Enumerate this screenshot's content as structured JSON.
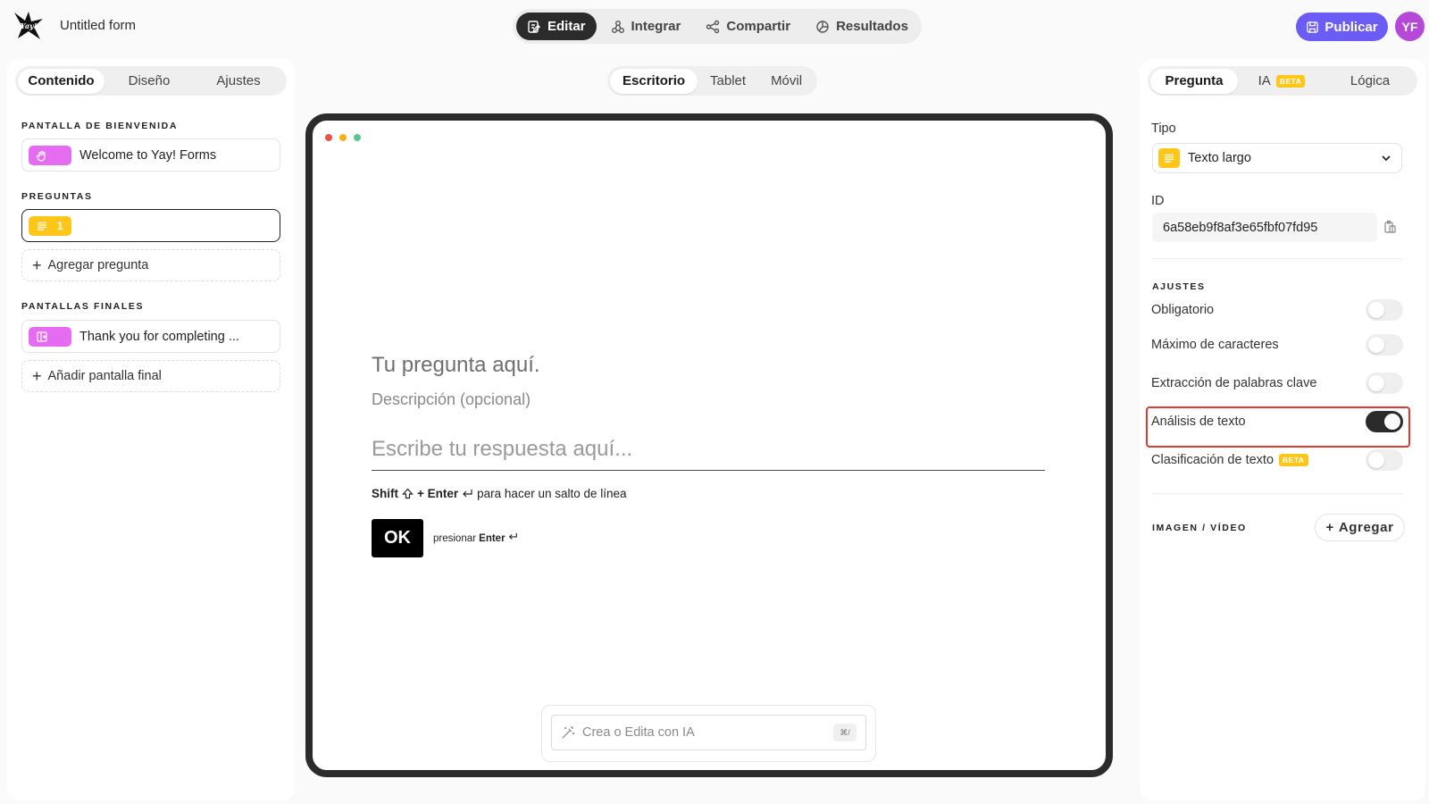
{
  "app": {
    "form_title": "Untitled form",
    "logo_icon": "yay-forms-logo",
    "accent_color": "#6a5cf5",
    "avatar_initials": "YF",
    "avatar_color": "#b548d8"
  },
  "top_nav": {
    "modes": [
      {
        "label": "Editar",
        "icon": "edit-icon",
        "active": true
      },
      {
        "label": "Integrar",
        "icon": "integrate-icon",
        "active": false
      },
      {
        "label": "Compartir",
        "icon": "share-icon",
        "active": false
      },
      {
        "label": "Resultados",
        "icon": "results-icon",
        "active": false
      }
    ],
    "publish_label": "Publicar"
  },
  "left_panel": {
    "tabs": [
      {
        "label": "Contenido",
        "active": true
      },
      {
        "label": "Diseño",
        "active": false
      },
      {
        "label": "Ajustes",
        "active": false
      }
    ],
    "welcome_section_label": "PANTALLA DE BIENVENIDA",
    "welcome_item": "Welcome to Yay! Forms",
    "questions_section_label": "PREGUNTAS",
    "question_number": "1",
    "add_question_label": "Agregar pregunta",
    "endings_section_label": "PANTALLAS FINALES",
    "ending_item": "Thank you for completing ...",
    "add_ending_label": "Añadir pantalla final"
  },
  "center": {
    "device_tabs": [
      {
        "label": "Escritorio",
        "active": true
      },
      {
        "label": "Tablet",
        "active": false
      },
      {
        "label": "Móvil",
        "active": false
      }
    ],
    "window_dots": [
      "#e5534b",
      "#f2b31a",
      "#5cc48c"
    ],
    "question_title": "Tu pregunta aquí.",
    "question_description": "Descripción (opcional)",
    "answer_placeholder": "Escribe tu respuesta aquí...",
    "hint_shift": "Shift",
    "hint_enter": "+ Enter",
    "hint_text": "para hacer un salto de línea",
    "ok_label": "OK",
    "press_prefix": "presionar",
    "press_key": "Enter",
    "ai_placeholder": "Crea o Edita con IA",
    "ai_shortcut": "⌘/"
  },
  "right_panel": {
    "tabs": [
      {
        "label": "Pregunta",
        "active": true,
        "beta": false
      },
      {
        "label": "IA",
        "active": false,
        "beta": true
      },
      {
        "label": "Lógica",
        "active": false,
        "beta": false
      }
    ],
    "beta_label": "BETA",
    "type_label": "Tipo",
    "type_value": "Texto largo",
    "id_label": "ID",
    "id_value": "6a58eb9f8af3e65fbf07fd95",
    "settings_label": "AJUSTES",
    "settings": [
      {
        "label": "Obligatorio",
        "on": false,
        "beta": false
      },
      {
        "label": "Máximo de caracteres",
        "on": false,
        "beta": false
      },
      {
        "label": "Extracción de palabras clave",
        "on": false,
        "beta": false
      },
      {
        "label": "Análisis de texto",
        "on": true,
        "beta": false,
        "highlighted": true
      },
      {
        "label": "Clasificación de texto",
        "on": false,
        "beta": true
      }
    ],
    "media_label": "IMAGEN / VÍDEO",
    "add_media_label": "Agregar",
    "highlight_color": "#e0392f"
  }
}
